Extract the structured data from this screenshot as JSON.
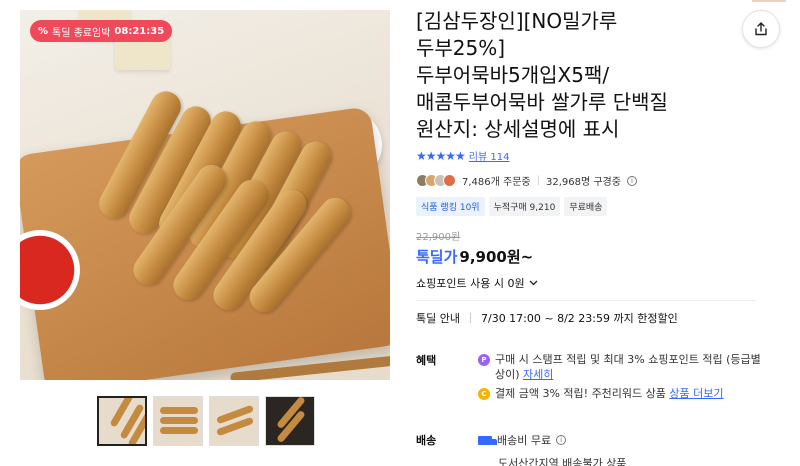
{
  "deal_badge": {
    "pct_icon": "%",
    "label": "톡딜 종료임박",
    "countdown": "08:21:35"
  },
  "product": {
    "title_lines": [
      "[김삼두장인][NO밀가루",
      "두부25%]",
      "두부어묵바5개입X5팩/",
      "매콤두부어묵바 쌀가루 단백질",
      "원산지: 상세설명에 표시"
    ],
    "stars": "★★★★★",
    "review_label": "리뷰",
    "review_count": "114",
    "orders": "7,486개 주문중",
    "subscribers": "32,968명 구경중",
    "tags": [
      "식품 랭킹 10위",
      "누적구매 9,210",
      "무료배송"
    ],
    "original_price": "22,900원",
    "deal_label": "톡딜가",
    "deal_price": "9,900원~",
    "points_text": "쇼핑포인트 사용 시 0원",
    "deal_info_label": "톡딜 안내",
    "deal_info_period": "7/30 17:00 ~ 8/2 23:59 까지 한정할인"
  },
  "benefits": {
    "label": "혜택",
    "items": [
      {
        "icon": "P",
        "text": "구매 시 스탬프 적립 및 최대 3% 쇼핑포인트 적립 (등급별 상이)",
        "link": "자세히"
      },
      {
        "icon": "C",
        "text": "결제 금액 3% 적립! 주천리워드 상품",
        "link": "상품 더보기"
      }
    ]
  },
  "shipping": {
    "label": "배송",
    "fee_text": "배송비 무료",
    "sub_text": "도서산간지역 배송불가 상품"
  },
  "colors": {
    "accent": "#346aff",
    "deal_badge": "#f04a5a"
  },
  "icons": [
    "share-icon",
    "chevron-down-icon",
    "info-icon",
    "truck-icon",
    "star-icon"
  ]
}
